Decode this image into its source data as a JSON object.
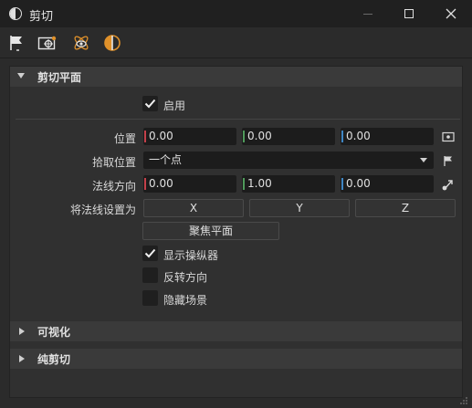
{
  "window": {
    "title": "剪切"
  },
  "toolbar": {
    "icons": [
      "flag-icon",
      "target-frame-icon",
      "atom-eye-icon",
      "half-circle-icon"
    ]
  },
  "sections": {
    "clip_plane": {
      "title": "剪切平面",
      "expanded": true
    },
    "visualize": {
      "title": "可视化",
      "expanded": false
    },
    "pure_clip": {
      "title": "纯剪切",
      "expanded": false
    }
  },
  "enable": {
    "label": "启用",
    "checked": true
  },
  "position": {
    "label": "位置",
    "x": "0.00",
    "y": "0.00",
    "z": "0.00"
  },
  "pick_position": {
    "label": "拾取位置",
    "value": "一个点"
  },
  "normal_direction": {
    "label": "法线方向",
    "x": "0.00",
    "y": "1.00",
    "z": "0.00"
  },
  "set_normal": {
    "label": "将法线设置为",
    "x_button": "X",
    "y_button": "Y",
    "z_button": "Z"
  },
  "focus_plane_button": "聚焦平面",
  "options": {
    "show_manipulator": {
      "label": "显示操纵器",
      "checked": true
    },
    "flip_direction": {
      "label": "反转方向",
      "checked": false
    },
    "hide_scene": {
      "label": "隐藏场景",
      "checked": false
    }
  },
  "colors": {
    "axis_x": "#c4404a",
    "axis_y": "#4f9a5a",
    "axis_z": "#3f86c4"
  }
}
